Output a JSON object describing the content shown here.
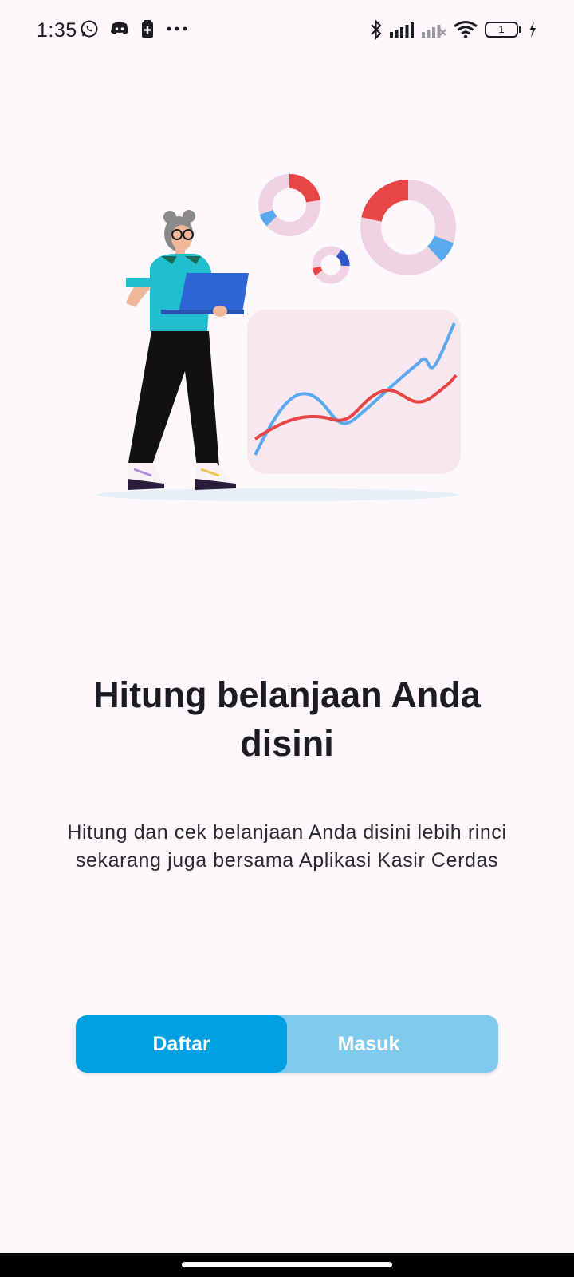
{
  "status_bar": {
    "time": "1:35",
    "left_icons": [
      "whatsapp-icon",
      "discord-icon",
      "battery-saver-icon",
      "more-dots-icon"
    ],
    "right_icons": [
      "bluetooth-icon",
      "signal-icon",
      "signal-no-service-icon",
      "wifi-icon",
      "battery-icon",
      "charging-icon"
    ],
    "battery_level": "1"
  },
  "illustration": {
    "description_icon": "analytics-illustration",
    "colors": {
      "red": "#e84545",
      "blue": "#5aa9ef",
      "pink": "#f0d3e0",
      "shirt": "#1fbfcf",
      "laptop": "#2f66d6"
    }
  },
  "onboarding": {
    "title": "Hitung belanjaan Anda disini",
    "description": "Hitung dan cek belanjaan Anda disini lebih rinci sekarang juga bersama Aplikasi Kasir Cerdas"
  },
  "auth_toggle": {
    "register_label": "Daftar",
    "login_label": "Masuk",
    "active": "Daftar",
    "colors": {
      "active_bg": "#00a0e3",
      "inactive_bg": "#80caee"
    }
  }
}
